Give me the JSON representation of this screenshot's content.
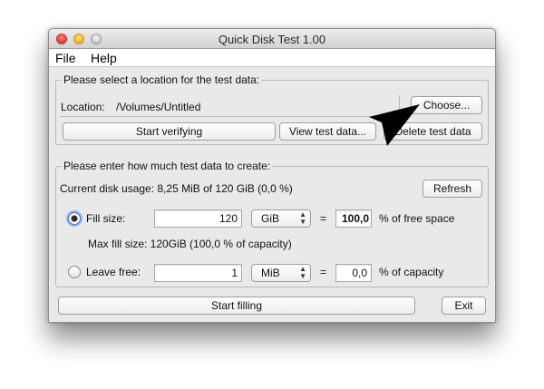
{
  "window": {
    "title": "Quick Disk Test 1.00"
  },
  "menu": {
    "items": [
      "File",
      "Help"
    ]
  },
  "location_group": {
    "legend": "Please select a location for the test data:",
    "location_label": "Location:",
    "location_value": "/Volumes/Untitled",
    "choose_button": "Choose...",
    "verify_button": "Start verifying",
    "view_button": "View test data...",
    "delete_button": "Delete test data"
  },
  "amount_group": {
    "legend": "Please enter how much test data to create:",
    "disk_usage": "Current disk usage: 8,25 MiB of 120 GiB (0,0 %)",
    "refresh_button": "Refresh",
    "fill_label": "Fill size:",
    "fill_value": "120",
    "fill_unit": "GiB",
    "equals": "=",
    "fill_percent": "100,0",
    "fill_suffix": "% of free space",
    "max_fill": "Max fill size: 120GiB (100,0 % of capacity)",
    "leave_label": "Leave free:",
    "leave_value": "1",
    "leave_unit": "MiB",
    "leave_percent": "0,0",
    "leave_suffix": "% of capacity"
  },
  "footer": {
    "start_button": "Start filling",
    "exit_button": "Exit"
  }
}
